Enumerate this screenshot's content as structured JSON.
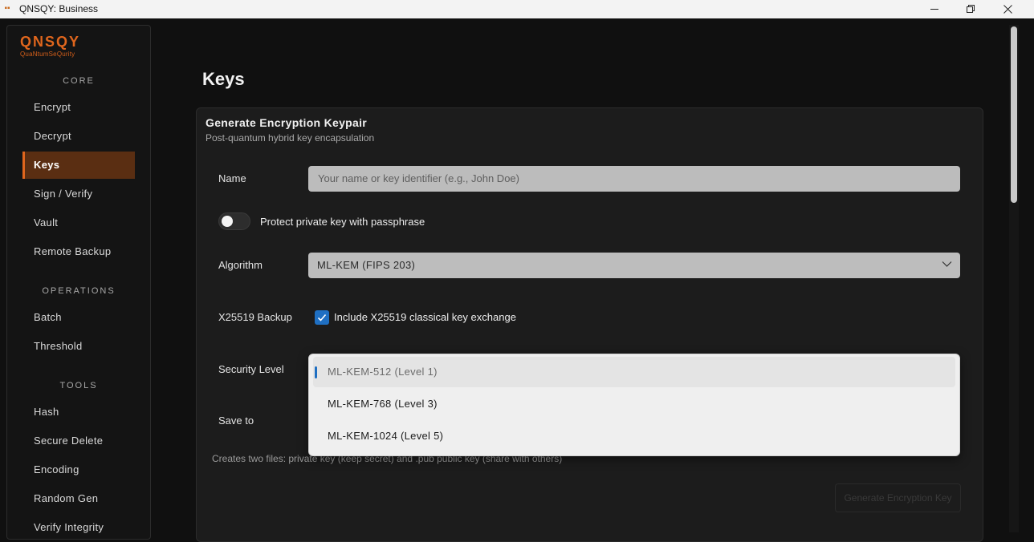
{
  "window": {
    "title": "QNSQY: Business",
    "icon": "app-icon",
    "controls": [
      "minimize-icon",
      "restore-icon",
      "close-icon"
    ]
  },
  "sidebar": {
    "logo": {
      "text": "QNSQY",
      "subtitle": "QuaNtumSeQurity"
    },
    "sections": [
      {
        "label": "CORE",
        "items": [
          "Encrypt",
          "Decrypt",
          "Keys",
          "Sign / Verify",
          "Vault",
          "Remote Backup"
        ]
      },
      {
        "label": "OPERATIONS",
        "items": [
          "Batch",
          "Threshold"
        ]
      },
      {
        "label": "TOOLS",
        "items": [
          "Hash",
          "Secure Delete",
          "Encoding",
          "Random Gen",
          "Verify Integrity"
        ]
      }
    ],
    "active_item": "Keys"
  },
  "page": {
    "title": "Keys"
  },
  "card": {
    "title": "Generate Encryption Keypair",
    "subtitle": "Post-quantum hybrid key encapsulation",
    "name_label": "Name",
    "name_placeholder": "Your name or key identifier (e.g., John Doe)",
    "name_value": "",
    "passphrase_toggle_label": "Protect private key with passphrase",
    "passphrase_enabled": false,
    "algorithm_label": "Algorithm",
    "algorithm_value": "ML-KEM (FIPS 203)",
    "x25519_label": "X25519 Backup",
    "x25519_checkbox_label": "Include X25519 classical key exchange",
    "x25519_checked": true,
    "security_level_label": "Security Level",
    "save_to_label": "Save to",
    "helper_text": "Creates two files: private key (keep secret) and .pub public key (share with others)",
    "generate_button": "Generate Encryption Key"
  },
  "security_level_dropdown": {
    "open": true,
    "selected": "ML-KEM-512 (Level 1)",
    "options": [
      "ML-KEM-512 (Level 1)",
      "ML-KEM-768 (Level 3)",
      "ML-KEM-1024 (Level 5)"
    ]
  },
  "colors": {
    "accent": "#e0661d",
    "active_nav_bg": "#5a2e12",
    "checkbox_blue": "#1f6fc2",
    "background": "#101010",
    "card_bg": "#1c1c1c"
  }
}
